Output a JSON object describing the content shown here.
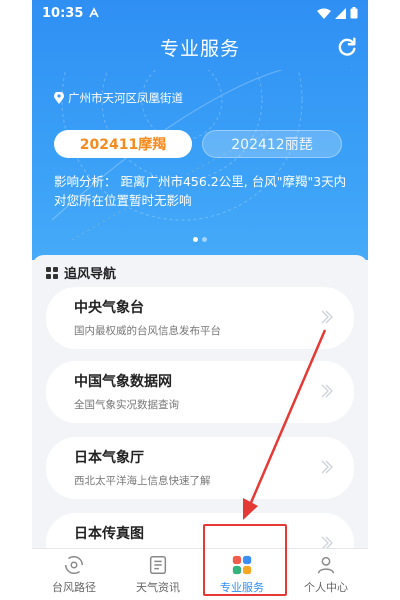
{
  "status_bar": {
    "time": "10:35",
    "battery": "▮"
  },
  "header": {
    "title": "专业服务"
  },
  "typhoon": {
    "location": "广州市天河区凤凰街道",
    "tabs": [
      {
        "label": "202411摩羯",
        "active": true
      },
      {
        "label": "202412丽琵",
        "active": false
      }
    ],
    "analysis": "影响分析： 距离广州市456.2公里, 台风\"摩羯\"3天内对您所在位置暂时无影响",
    "carousel_index": 1,
    "carousel_count": 2
  },
  "nav": {
    "title": "追风导航",
    "items": [
      {
        "name": "中央气象台",
        "desc": "国内最权威的台风信息发布平台"
      },
      {
        "name": "中国气象数据网",
        "desc": "全国气象实况数据查询"
      },
      {
        "name": "日本气象厅",
        "desc": "西北太平洋海上信息快速了解"
      },
      {
        "name": "日本传真图",
        "desc": ""
      }
    ]
  },
  "tabbar": {
    "items": [
      {
        "label": "台风路径",
        "icon": "typhoon-icon",
        "active": false
      },
      {
        "label": "天气资讯",
        "icon": "news-icon",
        "active": false
      },
      {
        "label": "专业服务",
        "icon": "grid-icon",
        "active": true
      },
      {
        "label": "个人中心",
        "icon": "person-icon",
        "active": false
      }
    ]
  },
  "colors": {
    "primary": "#2f8ff3",
    "accent": "#f58b1f",
    "annotation": "#e53935"
  }
}
